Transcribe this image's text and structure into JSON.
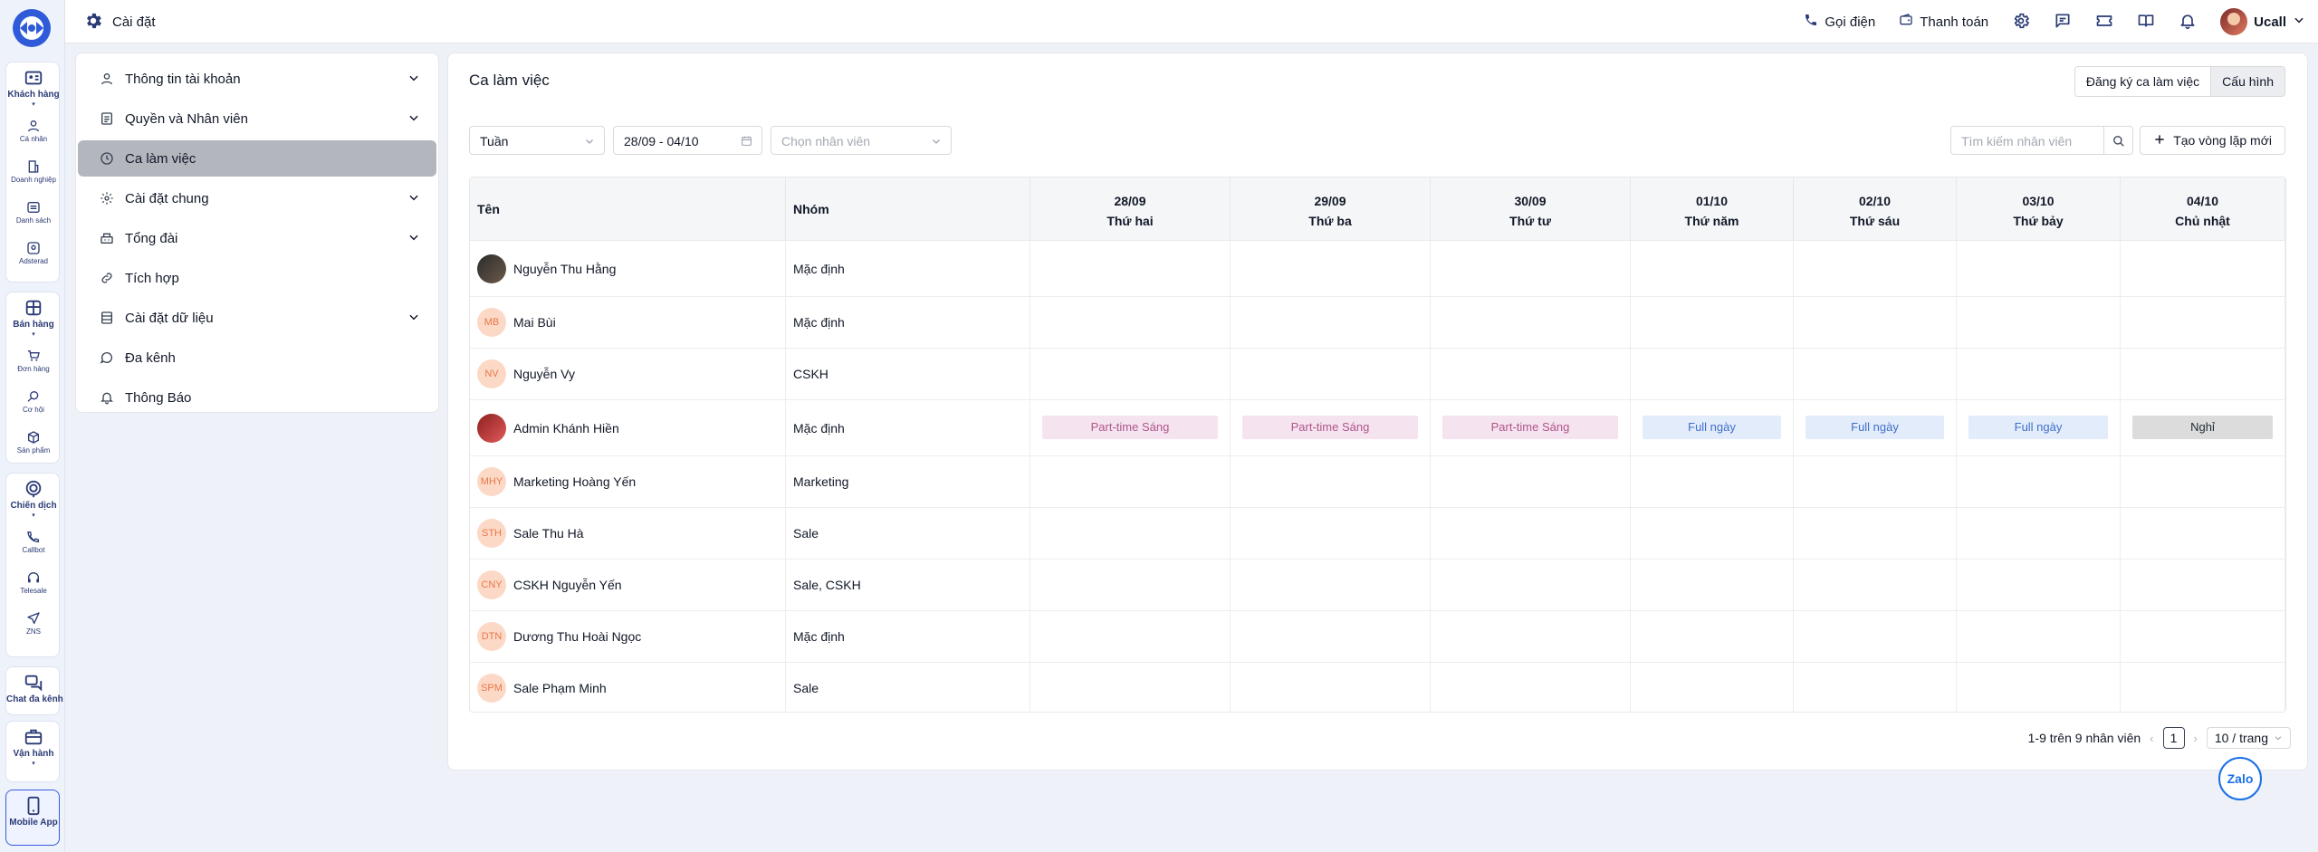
{
  "rail": {
    "groups": [
      {
        "label": "Khách hàng",
        "items": [
          "Cá nhân",
          "Doanh nghiệp",
          "Danh sách",
          "Adsterad"
        ]
      },
      {
        "label": "Bán hàng",
        "items": [
          "Đơn hàng",
          "Cơ hội",
          "Sản phẩm"
        ]
      },
      {
        "label": "Chiến dịch",
        "items": [
          "Callbot",
          "Telesale",
          "ZNS"
        ]
      },
      {
        "label": "Chat đa kênh",
        "items": []
      },
      {
        "label": "Vận hành",
        "items": []
      },
      {
        "label": "Mobile App",
        "items": []
      }
    ],
    "caret": "▾"
  },
  "header": {
    "title": "Cài đặt",
    "call": "Gọi điện",
    "payment": "Thanh toán",
    "user_name": "Ucall"
  },
  "menu": {
    "items": [
      {
        "label": "Thông tin tài khoản",
        "icon": "user-icon",
        "expandable": true,
        "active": false
      },
      {
        "label": "Quyền và Nhân viên",
        "icon": "roles-icon",
        "expandable": true,
        "active": false
      },
      {
        "label": "Ca làm việc",
        "icon": "clock-icon",
        "expandable": false,
        "active": true
      },
      {
        "label": "Cài đặt chung",
        "icon": "gear-icon",
        "expandable": true,
        "active": false
      },
      {
        "label": "Tổng đài",
        "icon": "switchboard-icon",
        "expandable": true,
        "active": false
      },
      {
        "label": "Tích hợp",
        "icon": "link-icon",
        "expandable": false,
        "active": false
      },
      {
        "label": "Cài đặt dữ liệu",
        "icon": "database-icon",
        "expandable": true,
        "active": false
      },
      {
        "label": "Đa kênh",
        "icon": "chat-icon",
        "expandable": false,
        "active": false
      },
      {
        "label": "Thông Báo",
        "icon": "bell-icon",
        "expandable": false,
        "active": false
      }
    ]
  },
  "main": {
    "title": "Ca làm việc",
    "register_btn": "Đăng ký ca làm việc",
    "config_btn": "Cấu hình",
    "view_select": "Tuần",
    "date_range": "28/09 - 04/10",
    "employee_placeholder": "Chọn nhân viên",
    "search_placeholder": "Tìm kiếm nhân viên",
    "new_cycle_btn": "Tạo vòng lặp mới"
  },
  "table": {
    "col_name": "Tên",
    "col_group": "Nhóm",
    "days": [
      {
        "date": "28/09",
        "weekday": "Thứ hai"
      },
      {
        "date": "29/09",
        "weekday": "Thứ ba"
      },
      {
        "date": "30/09",
        "weekday": "Thứ tư"
      },
      {
        "date": "01/10",
        "weekday": "Thứ năm"
      },
      {
        "date": "02/10",
        "weekday": "Thứ sáu"
      },
      {
        "date": "03/10",
        "weekday": "Thứ bảy"
      },
      {
        "date": "04/10",
        "weekday": "Chủ nhật"
      }
    ],
    "rows": [
      {
        "name": "Nguyễn Thu Hằng",
        "initials": "",
        "photo": 1,
        "group": "Mặc định",
        "shifts": []
      },
      {
        "name": "Mai Bùi",
        "initials": "MB",
        "photo": 0,
        "group": "Mặc định",
        "shifts": []
      },
      {
        "name": "Nguyễn Vy",
        "initials": "NV",
        "photo": 0,
        "group": "CSKH",
        "shifts": []
      },
      {
        "name": "Admin Khánh Hiền",
        "initials": "",
        "photo": 2,
        "group": "Mặc định",
        "shifts": [
          "Part-time Sáng",
          "Part-time Sáng",
          "Part-time Sáng",
          "Full ngày",
          "Full ngày",
          "Full ngày",
          "Nghỉ"
        ]
      },
      {
        "name": "Marketing Hoàng Yến",
        "initials": "MHY",
        "photo": 0,
        "group": "Marketing",
        "shifts": []
      },
      {
        "name": "Sale Thu Hà",
        "initials": "STH",
        "photo": 0,
        "group": "Sale",
        "shifts": []
      },
      {
        "name": "CSKH Nguyễn Yến",
        "initials": "CNY",
        "photo": 0,
        "group": "Sale, CSKH",
        "shifts": []
      },
      {
        "name": "Dương Thu Hoài Ngọc",
        "initials": "DTN",
        "photo": 0,
        "group": "Mặc định",
        "shifts": []
      },
      {
        "name": "Sale Phạm Minh",
        "initials": "SPM",
        "photo": 0,
        "group": "Sale",
        "shifts": []
      }
    ]
  },
  "shift_styles": {
    "Part-time Sáng": {
      "bg": "#f5e4ef",
      "fg": "#b0558a"
    },
    "Full ngày": {
      "bg": "#e3ecfb",
      "fg": "#3f6fc9"
    },
    "Nghỉ": {
      "bg": "#dcdcdc",
      "fg": "#1f2937"
    }
  },
  "pagination": {
    "summary": "1-9 trên 9 nhân viên",
    "page": "1",
    "page_size": "10 / trang",
    "prev": "‹",
    "next": "›"
  },
  "zalo": "Zalo"
}
